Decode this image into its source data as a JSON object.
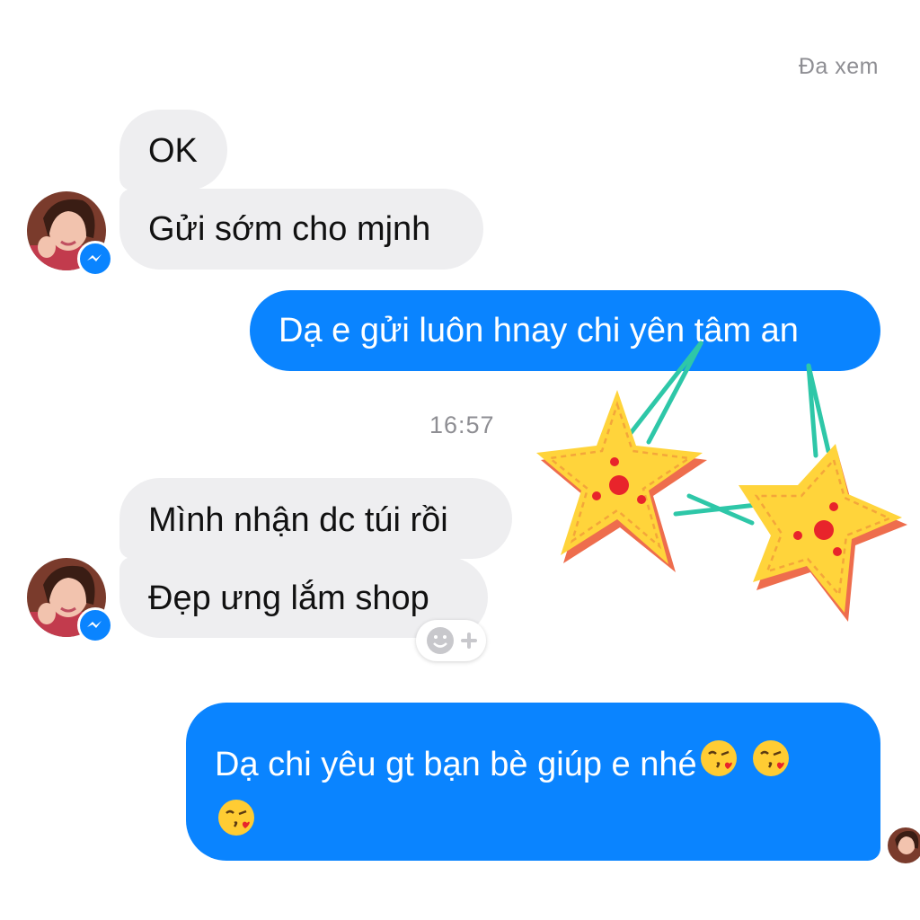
{
  "status": {
    "seen_label": "Đa xem"
  },
  "timestamp": "16:57",
  "messages": {
    "m1": "OK",
    "m2": "Gửi sớm cho mjnh",
    "m3": "Dạ e gửi luôn hnay chi yên tâm an",
    "m4": "Mình nhận dc túi rồi",
    "m5": "Đẹp ưng lắm shop",
    "m6": "Dạ chi yêu gt bạn bè giúp e nhé"
  },
  "icons": {
    "reaction": "smiley-plus-icon",
    "badge": "messenger-icon",
    "emoji": "face-blowing-kiss-emoji",
    "sticker": "starfish-sticker"
  },
  "colors": {
    "outgoing_bubble": "#0a84ff",
    "incoming_bubble": "#eeeef0"
  }
}
